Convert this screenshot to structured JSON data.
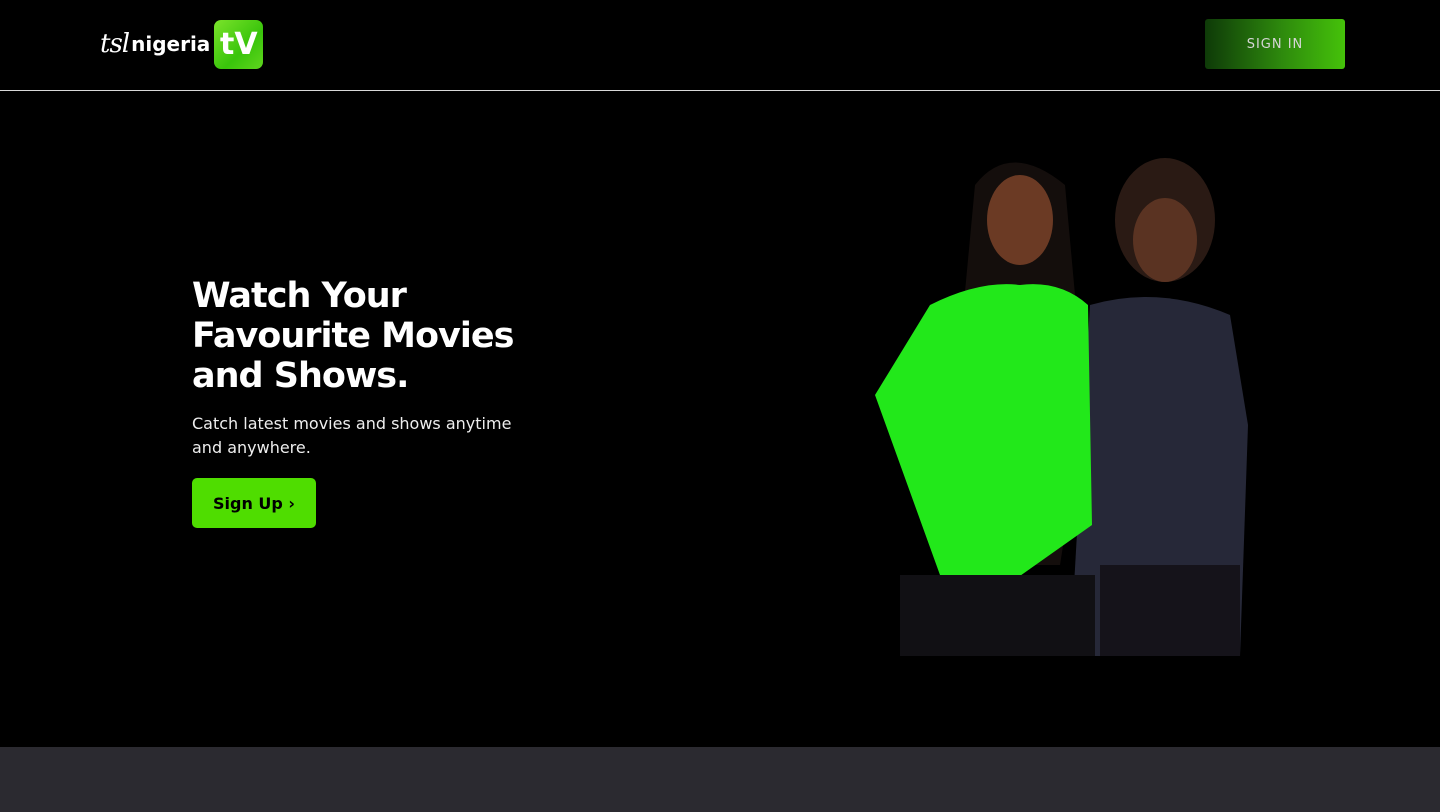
{
  "header": {
    "logo": {
      "text_script": "tsl",
      "text_main": "nigeria",
      "badge": "tV"
    },
    "signin_label": "SIGN IN"
  },
  "hero": {
    "title": "Watch Your Favourite Movies and Shows.",
    "subtitle": "Catch latest movies and shows anytime and anywhere.",
    "signup_label": "Sign Up ›"
  },
  "colors": {
    "accent": "#4fdd00",
    "footer_bg": "#2b2a30",
    "background": "#000000"
  }
}
